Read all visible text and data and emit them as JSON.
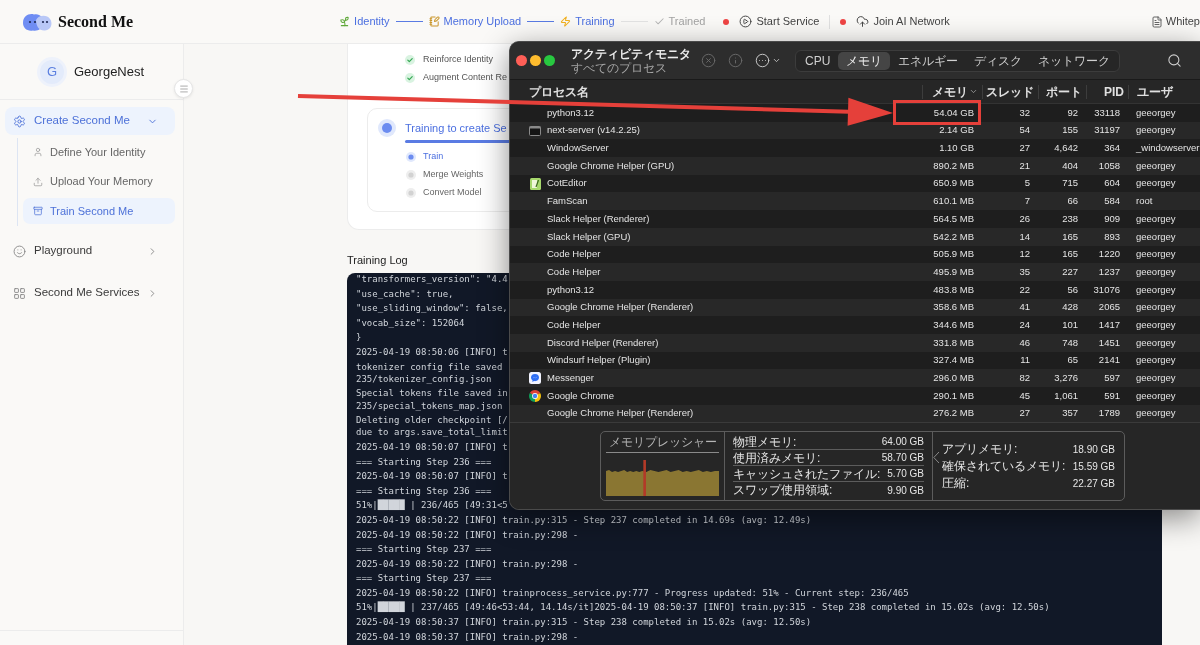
{
  "header": {
    "app_name": "Second Me",
    "steps": [
      {
        "label": "Identity",
        "reached": true
      },
      {
        "label": "Memory Upload",
        "reached": true
      },
      {
        "label": "Training",
        "reached": true
      },
      {
        "label": "Trained",
        "reached": false
      }
    ],
    "services": [
      {
        "label": "Start Service",
        "active": false
      },
      {
        "label": "Join AI Network",
        "active": false
      }
    ],
    "docs_link": "Whitep"
  },
  "sidebar": {
    "user": {
      "initial": "G",
      "name": "GeorgeNest"
    },
    "items": [
      {
        "label": "Create Second Me",
        "selected": true,
        "expanded": true,
        "children": [
          {
            "label": "Define Your Identity",
            "selected": false
          },
          {
            "label": "Upload Your Memory",
            "selected": false
          },
          {
            "label": "Train Second Me",
            "selected": true
          }
        ]
      },
      {
        "label": "Playground",
        "selected": false,
        "expanded": false
      },
      {
        "label": "Second Me Services",
        "selected": false,
        "expanded": false
      }
    ]
  },
  "main": {
    "previous_steps": [
      {
        "label": "Reinforce Identity",
        "done": true,
        "active": false
      },
      {
        "label": "Augment Content Re",
        "done": true,
        "active": false
      }
    ],
    "stage": {
      "title": "Training to create Se",
      "active": true,
      "steps": [
        {
          "label": "Train",
          "done": false,
          "active": true
        },
        {
          "label": "Merge Weights",
          "done": false,
          "active": false
        },
        {
          "label": "Convert Model",
          "done": false,
          "active": false
        }
      ]
    },
    "log": {
      "title": "Training Log",
      "entries": [
        [
          "\"transformers_version\": \"4.4"
        ],
        [
          "\"use_cache\": true,"
        ],
        [
          "\"use_sliding_window\": false,"
        ],
        [
          "\"vocab_size\": 152064"
        ],
        [
          "}"
        ],
        [
          "2025-04-19 08:50:06 [INFO] t"
        ],
        [
          "tokenizer config file saved",
          "235/tokenizer_config.json"
        ],
        [
          "Special tokens file saved in",
          "235/special_tokens_map.json"
        ],
        [
          "Deleting older checkpoint [/",
          "due to args.save_total_limit"
        ],
        [
          "2025-04-19 08:50:07 [INFO] t"
        ],
        [
          "=== Starting Step 236 ==="
        ],
        [
          "2025-04-19 08:50:07 [INFO] t"
        ],
        [
          "=== Starting Step 236 ==="
        ],
        [
          "51%|█████ | 236/465 [49:31<5"
        ],
        [
          "2025-04-19 08:50:22 [INFO] train.py:315 - Step 237 completed in 14.69s (avg: 12.49s)"
        ],
        [
          "2025-04-19 08:50:22 [INFO] train.py:298 -"
        ],
        [
          "=== Starting Step 237 ==="
        ],
        [
          "2025-04-19 08:50:22 [INFO] train.py:298 -"
        ],
        [
          "=== Starting Step 237 ==="
        ],
        [
          "2025-04-19 08:50:22 [INFO] trainprocess_service.py:777 - Progress updated: 51% - Current step: 236/465"
        ],
        [
          "51%|█████ | 237/465 [49:46<53:44, 14.14s/it]2025-04-19 08:50:37 [INFO] train.py:315 - Step 238 completed in 15.02s (avg: 12.50s)"
        ],
        [
          "2025-04-19 08:50:37 [INFO] train.py:315 - Step 238 completed in 15.02s (avg: 12.50s)"
        ],
        [
          "2025-04-19 08:50:37 [INFO] train.py:298 -"
        ]
      ]
    }
  },
  "activity_monitor": {
    "title": "アクティビティモニタ",
    "subtitle": "すべてのプロセス",
    "toolbar": [
      {
        "kind": "stop",
        "disabled": true
      },
      {
        "kind": "info",
        "disabled": true
      },
      {
        "kind": "more",
        "disabled": false
      }
    ],
    "tabs": [
      {
        "label": "CPU",
        "selected": false
      },
      {
        "label": "メモリ",
        "selected": true
      },
      {
        "label": "エネルギー",
        "selected": false
      },
      {
        "label": "ディスク",
        "selected": false
      },
      {
        "label": "ネットワーク",
        "selected": false
      }
    ],
    "columns": [
      {
        "label": "プロセス名",
        "sorted": false
      },
      {
        "label": "メモリ",
        "sorted": true
      },
      {
        "label": "スレッド",
        "sorted": false
      },
      {
        "label": "ポート",
        "sorted": false
      },
      {
        "label": "PID",
        "sorted": false
      },
      {
        "label": "ユーザ",
        "sorted": false
      }
    ],
    "rows": [
      {
        "kind": "none",
        "name": "python3.12",
        "memory": "54.04 GB",
        "threads": "32",
        "ports": "92",
        "pid": "33118",
        "user": "geeorgey",
        "highlighted": true
      },
      {
        "kind": "terminal",
        "name": "next-server (v14.2.25)",
        "memory": "2.14 GB",
        "threads": "54",
        "ports": "155",
        "pid": "31197",
        "user": "geeorgey",
        "highlighted": false
      },
      {
        "kind": "none",
        "name": "WindowServer",
        "memory": "1.10 GB",
        "threads": "27",
        "ports": "4,642",
        "pid": "364",
        "user": "_windowserver",
        "highlighted": false
      },
      {
        "kind": "none",
        "name": "Google Chrome Helper (GPU)",
        "memory": "890.2 MB",
        "threads": "21",
        "ports": "404",
        "pid": "1058",
        "user": "geeorgey",
        "highlighted": false
      },
      {
        "kind": "editor",
        "name": "CotEditor",
        "memory": "650.9 MB",
        "threads": "5",
        "ports": "715",
        "pid": "604",
        "user": "geeorgey",
        "highlighted": false
      },
      {
        "kind": "none",
        "name": "FamScan",
        "memory": "610.1 MB",
        "threads": "7",
        "ports": "66",
        "pid": "584",
        "user": "root",
        "highlighted": false
      },
      {
        "kind": "none",
        "name": "Slack Helper (Renderer)",
        "memory": "564.5 MB",
        "threads": "26",
        "ports": "238",
        "pid": "909",
        "user": "geeorgey",
        "highlighted": false
      },
      {
        "kind": "none",
        "name": "Slack Helper (GPU)",
        "memory": "542.2 MB",
        "threads": "14",
        "ports": "165",
        "pid": "893",
        "user": "geeorgey",
        "highlighted": false
      },
      {
        "kind": "none",
        "name": "Code Helper",
        "memory": "505.9 MB",
        "threads": "12",
        "ports": "165",
        "pid": "1220",
        "user": "geeorgey",
        "highlighted": false
      },
      {
        "kind": "none",
        "name": "Code Helper",
        "memory": "495.9 MB",
        "threads": "35",
        "ports": "227",
        "pid": "1237",
        "user": "geeorgey",
        "highlighted": false
      },
      {
        "kind": "none",
        "name": "python3.12",
        "memory": "483.8 MB",
        "threads": "22",
        "ports": "56",
        "pid": "31076",
        "user": "geeorgey",
        "highlighted": false
      },
      {
        "kind": "none",
        "name": "Google Chrome Helper (Renderer)",
        "memory": "358.6 MB",
        "threads": "41",
        "ports": "428",
        "pid": "2065",
        "user": "geeorgey",
        "highlighted": false
      },
      {
        "kind": "none",
        "name": "Code Helper",
        "memory": "344.6 MB",
        "threads": "24",
        "ports": "101",
        "pid": "1417",
        "user": "geeorgey",
        "highlighted": false
      },
      {
        "kind": "none",
        "name": "Discord Helper (Renderer)",
        "memory": "331.8 MB",
        "threads": "46",
        "ports": "748",
        "pid": "1451",
        "user": "geeorgey",
        "highlighted": false
      },
      {
        "kind": "none",
        "name": "Windsurf Helper (Plugin)",
        "memory": "327.4 MB",
        "threads": "11",
        "ports": "65",
        "pid": "2141",
        "user": "geeorgey",
        "highlighted": false
      },
      {
        "kind": "chat",
        "name": "Messenger",
        "memory": "296.0 MB",
        "threads": "82",
        "ports": "3,276",
        "pid": "597",
        "user": "geeorgey",
        "highlighted": false
      },
      {
        "kind": "browser",
        "name": "Google Chrome",
        "memory": "290.1 MB",
        "threads": "45",
        "ports": "1,061",
        "pid": "591",
        "user": "geeorgey",
        "highlighted": false
      },
      {
        "kind": "none",
        "name": "Google Chrome Helper (Renderer)",
        "memory": "276.2 MB",
        "threads": "27",
        "ports": "357",
        "pid": "1789",
        "user": "geeorgey",
        "highlighted": false
      }
    ],
    "memory_pressure": {
      "title": "メモリプレッシャー"
    },
    "memory_stats": [
      {
        "label": "物理メモリ:",
        "value": "64.00 GB",
        "pointed": false
      },
      {
        "label": "使用済みメモリ:",
        "value": "58.70 GB",
        "pointed": true
      },
      {
        "label": "キャッシュされたファイル:",
        "value": "5.70 GB",
        "pointed": false
      },
      {
        "label": "スワップ使用領域:",
        "value": "9.90 GB",
        "pointed": false
      }
    ],
    "app_stats": [
      {
        "label": "アプリメモリ:",
        "value": "18.90 GB"
      },
      {
        "label": "確保されているメモリ:",
        "value": "15.59 GB"
      },
      {
        "label": "圧縮:",
        "value": "22.27 GB"
      }
    ]
  }
}
